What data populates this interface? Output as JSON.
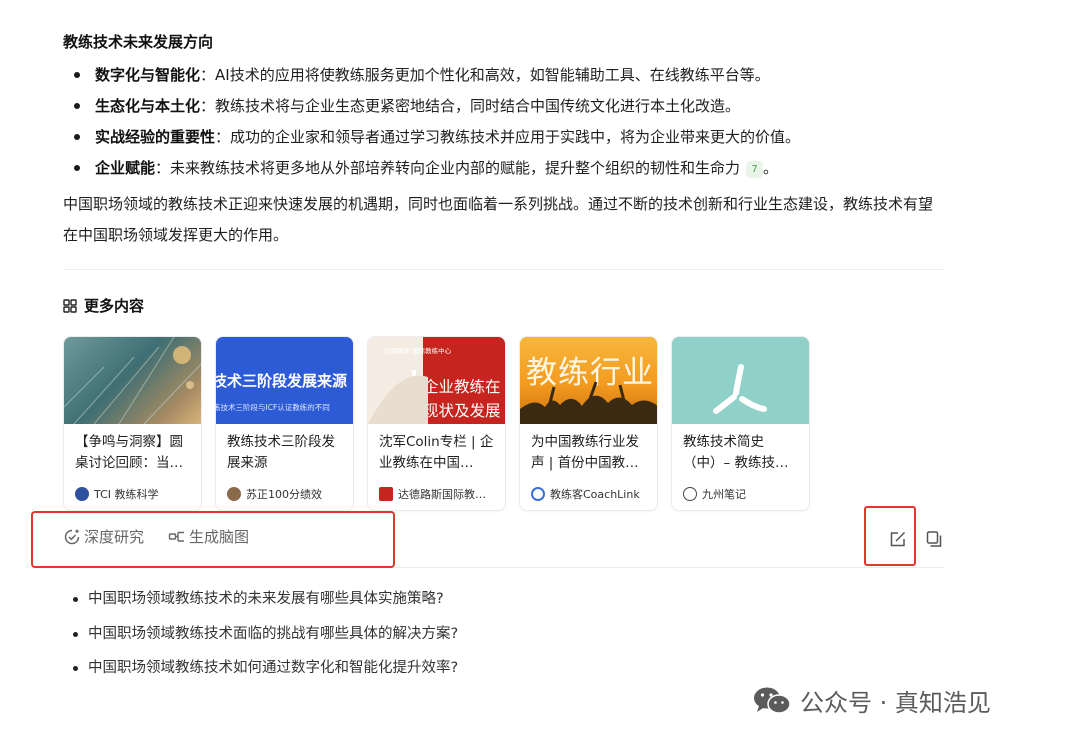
{
  "section_heading": "教练技术未来发展方向",
  "bullets": [
    {
      "bold": "数字化与智能化",
      "text": "：AI技术的应用将使教练服务更加个性化和高效，如智能辅助工具、在线教练平台等。"
    },
    {
      "bold": "生态化与本土化",
      "text": "：教练技术将与企业生态更紧密地结合，同时结合中国传统文化进行本土化改造。"
    },
    {
      "bold": "实战经验的重要性",
      "text": "：成功的企业家和领导者通过学习教练技术并应用于实践中，将为企业带来更大的价值。"
    },
    {
      "bold": "企业赋能",
      "text": "：未来教练技术将更多地从外部培养转向企业内部的赋能，提升整个组织的韧性和生命力",
      "cite": "7",
      "tail": "。"
    }
  ],
  "summary": "中国职场领域的教练技术正迎来快速发展的机遇期，同时也面临着一系列挑战。通过不断的技术创新和行业生态建设，教练技术有望在中国职场领域发挥更大的作用。",
  "more_content": {
    "title": "更多内容",
    "cards": [
      {
        "title": "【争鸣与洞察】圆桌讨论回顾：当…",
        "source": "TCI 教练科学",
        "icon_color": "#2f4fa0"
      },
      {
        "title": "教练技术三阶段发展来源",
        "source": "苏正100分绩效",
        "icon_color": "#8a6a4a",
        "thumb_line1": "技术三阶段发展来源",
        "thumb_line2": "练技术三阶段与ICF认证教练的不同"
      },
      {
        "title": "沈军Colin专栏 | 企业教练在中国…",
        "source": "达德路斯国际教…",
        "icon_color": "#c6241e",
        "thumb_top": "达德路斯 国际教练中心",
        "thumb_line1": "企业教练在",
        "thumb_line2": "现状及发展"
      },
      {
        "title": "为中国教练行业发声 | 首份中国教…",
        "source": "教练客CoachLink",
        "icon_color": "#3b6fd8",
        "thumb_line1": "教练行业"
      },
      {
        "title": "教练技术简史（中）– 教练技…",
        "source": "九州笔记",
        "icon_color": "#444444"
      }
    ]
  },
  "actions": {
    "deep_research": "深度研究",
    "mind_map": "生成脑图"
  },
  "followups": [
    "中国职场领域教练技术的未来发展有哪些具体实施策略?",
    "中国职场领域教练技术面临的挑战有哪些具体的解决方案?",
    "中国职场领域教练技术如何通过数字化和智能化提升效率?"
  ],
  "watermark": "公众号 · 真知浩见",
  "colors": {
    "highlight": "#e0392c",
    "cite_bg": "#eaf5ea",
    "cite_text": "#52a052"
  }
}
